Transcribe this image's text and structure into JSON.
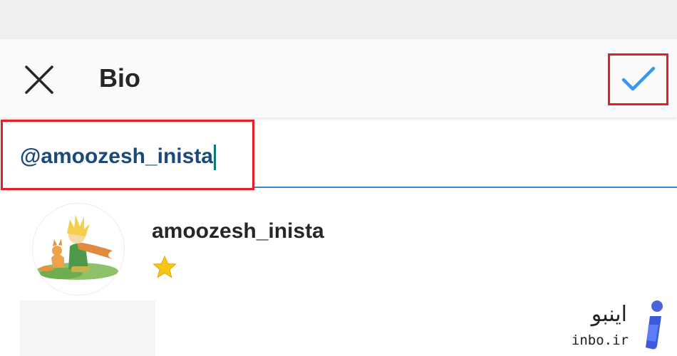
{
  "header": {
    "title": "Bio",
    "close_icon": "close-icon",
    "confirm_icon": "checkmark-icon",
    "confirm_color": "#3897f0"
  },
  "bio": {
    "value": "@amoozesh_inista"
  },
  "suggestion": {
    "username": "amoozesh_inista",
    "emoji": "star-emoji"
  },
  "highlight_color": "#e31e24",
  "watermark": {
    "name": "اینبو",
    "domain": "inbo.ir"
  }
}
